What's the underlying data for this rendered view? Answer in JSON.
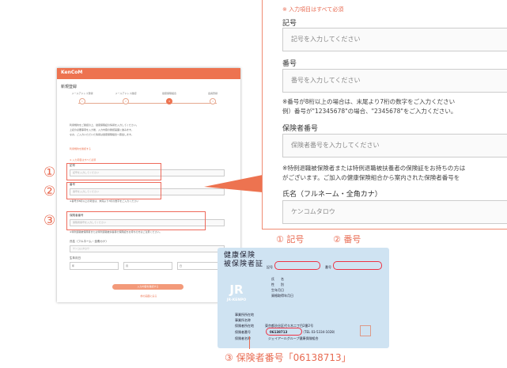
{
  "colors": {
    "accent": "#ed7350",
    "highlight": "#ee6a5b",
    "card": "#cfe3f2"
  },
  "mini": {
    "logo": "KenCoM",
    "title": "新規登録",
    "steps": [
      {
        "label": "メールアドレス登録",
        "num": "1"
      },
      {
        "label": "メールアドレス確認",
        "num": "2"
      },
      {
        "label": "健康保険組合",
        "num": "3"
      },
      {
        "label": "会員登録",
        "num": "4"
      }
    ],
    "intro": [
      "利用規約をご確認の上、健康保険証の情報を入力してください。",
      "上記の必要事項を入力後、入力内容の確認画面に進みます。",
      "なお、ご入力いただいた情報は健康保険組合へ照会します。"
    ],
    "intro_link": "利用規約を確認する",
    "required_note": "※ 入力項目はすべて必須",
    "symbol_label": "記号",
    "symbol_placeholder": "記号を入力してください",
    "number_label": "番号",
    "number_placeholder": "番号を入力してください",
    "number_note": "※番号が8桁以上の場合は、末尾より7桁の数字をご入力ください",
    "insured_label": "保険者番号",
    "insured_placeholder": "保険者番号を入力してください",
    "insured_note": "※特例退職被保険者または特例退職被扶養者の保険証をお持ちの方はご注意ください。",
    "name_label": "氏名（フルネーム・全角カナ）",
    "name_placeholder": "ケンコムタロウ",
    "birth_label": "生年月日",
    "selects": [
      "年",
      "月",
      "日"
    ],
    "submit": "入力内容を確認する",
    "back": "前の画面に戻る"
  },
  "markers": {
    "one": "①",
    "two": "②",
    "three": "③"
  },
  "zoom": {
    "required_note": "※ 入力項目はすべて必須",
    "symbol_label": "記号",
    "symbol_placeholder": "記号を入力してください",
    "number_label": "番号",
    "number_placeholder": "番号を入力してください",
    "number_note_1": "※番号が8桁以上の場合は、末尾より7桁の数字をご入力ください",
    "number_note_2": "例）番号が\"12345678\"の場合、\"2345678\"をご入力ください。",
    "insured_label": "保険者番号",
    "insured_placeholder": "保険者番号を入力してください",
    "insured_note_1": "※特例退職被保険者または特例退職被扶養者の保険証をお持ちの方は",
    "insured_note_2": "がございます。ご加入の健康保険組合から案内された保険者番号を",
    "name_label": "氏名（フルネーム・全角カナ）",
    "name_placeholder": "ケンコムタロウ"
  },
  "card": {
    "title_1": "健康保険",
    "title_2": "被保険者証",
    "symbol": "記号",
    "number": "番号",
    "logo": "JR",
    "logo_sub": "JR-KENPO",
    "fields": [
      "氏　　名",
      "性　　別",
      "生年月日",
      "資格取得年月日"
    ],
    "lower_fields": [
      "事業所所在地",
      "事業所名称",
      "保険者所在地",
      "保険者番号",
      "保険者名称"
    ],
    "address": "東京都渋谷区代々木二丁目2番2号",
    "insurer_no": "06138713",
    "tel": "（TEL 03-5334-1028）",
    "insurer_name": "ジェイアールグループ健康保険組合"
  },
  "card_labels": {
    "symbol": "① 記号",
    "number": "② 番号"
  },
  "caption": "③ 保険者番号「06138713」"
}
